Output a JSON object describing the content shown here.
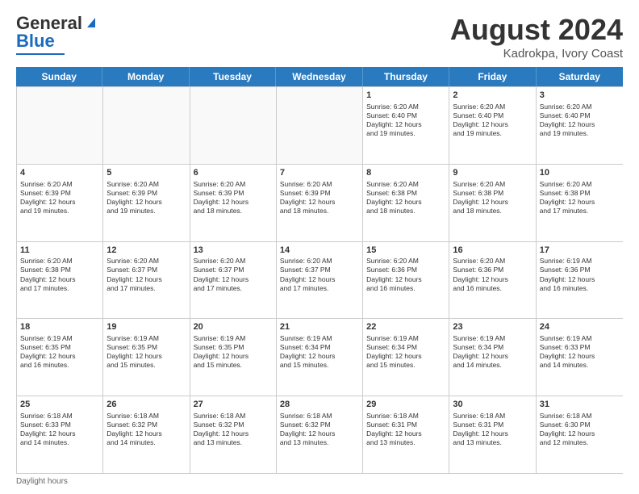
{
  "header": {
    "logo_general": "General",
    "logo_blue": "Blue",
    "month_year": "August 2024",
    "location": "Kadrokpa, Ivory Coast"
  },
  "days_of_week": [
    "Sunday",
    "Monday",
    "Tuesday",
    "Wednesday",
    "Thursday",
    "Friday",
    "Saturday"
  ],
  "weeks": [
    [
      {
        "day": "",
        "info": ""
      },
      {
        "day": "",
        "info": ""
      },
      {
        "day": "",
        "info": ""
      },
      {
        "day": "",
        "info": ""
      },
      {
        "day": "1",
        "info": "Sunrise: 6:20 AM\nSunset: 6:40 PM\nDaylight: 12 hours\nand 19 minutes."
      },
      {
        "day": "2",
        "info": "Sunrise: 6:20 AM\nSunset: 6:40 PM\nDaylight: 12 hours\nand 19 minutes."
      },
      {
        "day": "3",
        "info": "Sunrise: 6:20 AM\nSunset: 6:40 PM\nDaylight: 12 hours\nand 19 minutes."
      }
    ],
    [
      {
        "day": "4",
        "info": "Sunrise: 6:20 AM\nSunset: 6:39 PM\nDaylight: 12 hours\nand 19 minutes."
      },
      {
        "day": "5",
        "info": "Sunrise: 6:20 AM\nSunset: 6:39 PM\nDaylight: 12 hours\nand 19 minutes."
      },
      {
        "day": "6",
        "info": "Sunrise: 6:20 AM\nSunset: 6:39 PM\nDaylight: 12 hours\nand 18 minutes."
      },
      {
        "day": "7",
        "info": "Sunrise: 6:20 AM\nSunset: 6:39 PM\nDaylight: 12 hours\nand 18 minutes."
      },
      {
        "day": "8",
        "info": "Sunrise: 6:20 AM\nSunset: 6:38 PM\nDaylight: 12 hours\nand 18 minutes."
      },
      {
        "day": "9",
        "info": "Sunrise: 6:20 AM\nSunset: 6:38 PM\nDaylight: 12 hours\nand 18 minutes."
      },
      {
        "day": "10",
        "info": "Sunrise: 6:20 AM\nSunset: 6:38 PM\nDaylight: 12 hours\nand 17 minutes."
      }
    ],
    [
      {
        "day": "11",
        "info": "Sunrise: 6:20 AM\nSunset: 6:38 PM\nDaylight: 12 hours\nand 17 minutes."
      },
      {
        "day": "12",
        "info": "Sunrise: 6:20 AM\nSunset: 6:37 PM\nDaylight: 12 hours\nand 17 minutes."
      },
      {
        "day": "13",
        "info": "Sunrise: 6:20 AM\nSunset: 6:37 PM\nDaylight: 12 hours\nand 17 minutes."
      },
      {
        "day": "14",
        "info": "Sunrise: 6:20 AM\nSunset: 6:37 PM\nDaylight: 12 hours\nand 17 minutes."
      },
      {
        "day": "15",
        "info": "Sunrise: 6:20 AM\nSunset: 6:36 PM\nDaylight: 12 hours\nand 16 minutes."
      },
      {
        "day": "16",
        "info": "Sunrise: 6:20 AM\nSunset: 6:36 PM\nDaylight: 12 hours\nand 16 minutes."
      },
      {
        "day": "17",
        "info": "Sunrise: 6:19 AM\nSunset: 6:36 PM\nDaylight: 12 hours\nand 16 minutes."
      }
    ],
    [
      {
        "day": "18",
        "info": "Sunrise: 6:19 AM\nSunset: 6:35 PM\nDaylight: 12 hours\nand 16 minutes."
      },
      {
        "day": "19",
        "info": "Sunrise: 6:19 AM\nSunset: 6:35 PM\nDaylight: 12 hours\nand 15 minutes."
      },
      {
        "day": "20",
        "info": "Sunrise: 6:19 AM\nSunset: 6:35 PM\nDaylight: 12 hours\nand 15 minutes."
      },
      {
        "day": "21",
        "info": "Sunrise: 6:19 AM\nSunset: 6:34 PM\nDaylight: 12 hours\nand 15 minutes."
      },
      {
        "day": "22",
        "info": "Sunrise: 6:19 AM\nSunset: 6:34 PM\nDaylight: 12 hours\nand 15 minutes."
      },
      {
        "day": "23",
        "info": "Sunrise: 6:19 AM\nSunset: 6:34 PM\nDaylight: 12 hours\nand 14 minutes."
      },
      {
        "day": "24",
        "info": "Sunrise: 6:19 AM\nSunset: 6:33 PM\nDaylight: 12 hours\nand 14 minutes."
      }
    ],
    [
      {
        "day": "25",
        "info": "Sunrise: 6:18 AM\nSunset: 6:33 PM\nDaylight: 12 hours\nand 14 minutes."
      },
      {
        "day": "26",
        "info": "Sunrise: 6:18 AM\nSunset: 6:32 PM\nDaylight: 12 hours\nand 14 minutes."
      },
      {
        "day": "27",
        "info": "Sunrise: 6:18 AM\nSunset: 6:32 PM\nDaylight: 12 hours\nand 13 minutes."
      },
      {
        "day": "28",
        "info": "Sunrise: 6:18 AM\nSunset: 6:32 PM\nDaylight: 12 hours\nand 13 minutes."
      },
      {
        "day": "29",
        "info": "Sunrise: 6:18 AM\nSunset: 6:31 PM\nDaylight: 12 hours\nand 13 minutes."
      },
      {
        "day": "30",
        "info": "Sunrise: 6:18 AM\nSunset: 6:31 PM\nDaylight: 12 hours\nand 13 minutes."
      },
      {
        "day": "31",
        "info": "Sunrise: 6:18 AM\nSunset: 6:30 PM\nDaylight: 12 hours\nand 12 minutes."
      }
    ]
  ],
  "footer": {
    "label": "Daylight hours"
  }
}
